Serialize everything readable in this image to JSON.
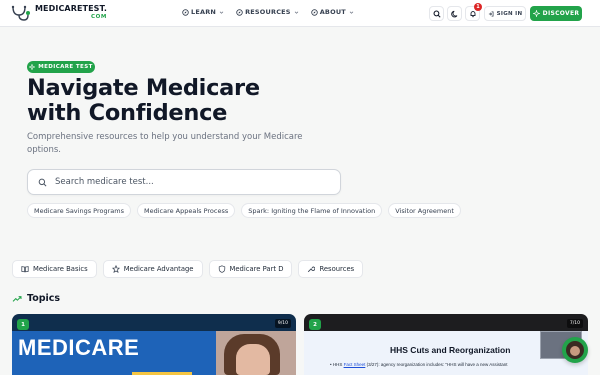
{
  "header": {
    "logo_text": "MEDICARETEST.",
    "logo_suffix": "COM",
    "nav": [
      {
        "label": "LEARN",
        "icon": "compass-icon"
      },
      {
        "label": "RESOURCES",
        "icon": "compass-icon"
      },
      {
        "label": "ABOUT",
        "icon": "compass-icon"
      }
    ],
    "notification_count": "1",
    "signin_label": "SIGN IN",
    "discover_label": "DISCOVER"
  },
  "hero": {
    "badge": "MEDICARE TEST",
    "title": "Navigate Medicare with Confidence",
    "subtitle": "Comprehensive resources to help you understand your Medicare options.",
    "search_placeholder": "Search medicare test..."
  },
  "quick_links": [
    "Medicare Savings Programs",
    "Medicare Appeals Process",
    "Spark: Igniting the Flame of Innovation",
    "Visitor Agreement"
  ],
  "categories": [
    {
      "label": "Medicare Basics",
      "icon": "book-icon"
    },
    {
      "label": "Medicare Advantage",
      "icon": "star-icon"
    },
    {
      "label": "Medicare Part D",
      "icon": "shield-icon"
    },
    {
      "label": "Resources",
      "icon": "wrench-icon"
    }
  ],
  "topics": {
    "title": "Topics",
    "cards": [
      {
        "number": "1",
        "rating": "9/10",
        "image_text": "MEDICARE"
      },
      {
        "number": "2",
        "rating": "7/10",
        "image_title": "HHS Cuts and Reorganization",
        "image_line_pre": "• HHS ",
        "image_line_link": "Fact Sheet",
        "image_line_post": " (3/27): agency reorganization includes: \"HHS will have a new Assistant"
      }
    ]
  },
  "colors": {
    "accent": "#22a34a",
    "notification": "#dc2626"
  }
}
